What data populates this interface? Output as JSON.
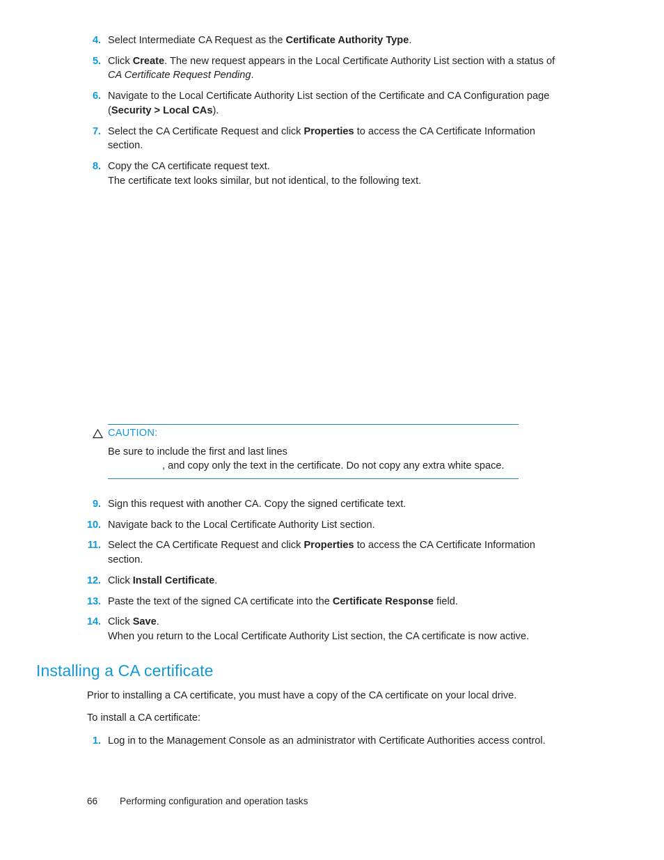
{
  "page": {
    "footer_page_number": "66",
    "footer_title": "Performing configuration and operation tasks"
  },
  "steps_top": [
    {
      "number": "4.",
      "segments": [
        {
          "text": "Select Intermediate CA Request as the ",
          "style": "normal"
        },
        {
          "text": "Certificate Authority Type",
          "style": "bold"
        },
        {
          "text": ".",
          "style": "normal"
        }
      ]
    },
    {
      "number": "5.",
      "segments": [
        {
          "text": "Click ",
          "style": "normal"
        },
        {
          "text": "Create",
          "style": "bold"
        },
        {
          "text": ". The new request appears in the Local Certificate Authority List section with a status of ",
          "style": "normal"
        },
        {
          "text": "CA Certificate Request Pending",
          "style": "italic"
        },
        {
          "text": ".",
          "style": "normal"
        }
      ]
    },
    {
      "number": "6.",
      "segments": [
        {
          "text": "Navigate to the Local Certificate Authority List section of the Certificate and CA Configuration page (",
          "style": "normal"
        },
        {
          "text": "Security > Local CAs",
          "style": "bold"
        },
        {
          "text": ").",
          "style": "normal"
        }
      ]
    },
    {
      "number": "7.",
      "segments": [
        {
          "text": "Select the CA Certificate Request and click ",
          "style": "normal"
        },
        {
          "text": "Properties",
          "style": "bold"
        },
        {
          "text": " to access the CA Certificate Information section.",
          "style": "normal"
        }
      ]
    },
    {
      "number": "8.",
      "segments": [
        {
          "text": "Copy the CA certificate request text.",
          "style": "normal"
        }
      ]
    }
  ],
  "steps_top_continuation": "The certificate text looks similar, but not identical, to the following text.",
  "code_block": {
    "content": ""
  },
  "caution": {
    "icon": "warning-triangle-icon",
    "title": "CAUTION:",
    "body_line_1": "Be sure to include the first and last lines",
    "body_line_2": ", and copy only the text in the certificate. Do not copy any extra white space."
  },
  "steps_mid": [
    {
      "number": "9.",
      "segments": [
        {
          "text": "Sign this request with another CA. Copy the signed certificate text.",
          "style": "normal"
        }
      ]
    },
    {
      "number": "10.",
      "segments": [
        {
          "text": "Navigate back to the Local Certificate Authority List section.",
          "style": "normal"
        }
      ]
    },
    {
      "number": "11.",
      "segments": [
        {
          "text": "Select the CA Certificate Request and click ",
          "style": "normal"
        },
        {
          "text": "Properties",
          "style": "bold"
        },
        {
          "text": " to access the CA Certificate Information section.",
          "style": "normal"
        }
      ]
    },
    {
      "number": "12.",
      "segments": [
        {
          "text": "Click ",
          "style": "normal"
        },
        {
          "text": "Install Certificate",
          "style": "bold"
        },
        {
          "text": ".",
          "style": "normal"
        }
      ]
    },
    {
      "number": "13.",
      "segments": [
        {
          "text": "Paste the text of the signed CA certificate into the ",
          "style": "normal"
        },
        {
          "text": "Certificate Response",
          "style": "bold"
        },
        {
          "text": " field.",
          "style": "normal"
        }
      ]
    },
    {
      "number": "14.",
      "segments": [
        {
          "text": "Click ",
          "style": "normal"
        },
        {
          "text": "Save",
          "style": "bold"
        },
        {
          "text": ".",
          "style": "normal"
        }
      ]
    }
  ],
  "steps_mid_continuation": "When you return to the Local Certificate Authority List section, the CA certificate is now active.",
  "section": {
    "heading": "Installing a CA certificate",
    "paragraphs": [
      "Prior to installing a CA certificate, you must have a copy of the CA certificate on your local drive.",
      "To install a CA certificate:"
    ],
    "steps": [
      {
        "number": "1.",
        "segments": [
          {
            "text": "Log in to the Management Console as an administrator with Certificate Authorities access control.",
            "style": "normal"
          }
        ]
      }
    ]
  },
  "colors": {
    "accent_blue": "#0f9ad6",
    "rule_blue": "#1b87b8",
    "body_text": "#231f20"
  }
}
